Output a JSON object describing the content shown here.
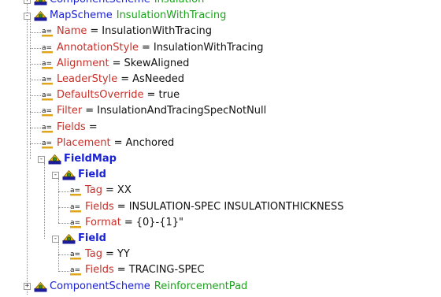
{
  "tree": {
    "rows": [
      {
        "type": "element",
        "name": "ComponentScheme",
        "value": "Insulation",
        "bold": false,
        "expander": "+"
      },
      {
        "type": "element",
        "name": "MapScheme",
        "value": "InsulationWithTracing",
        "bold": false,
        "expander": "-"
      },
      {
        "type": "attribute",
        "name": "Name",
        "value": "InsulationWithTracing"
      },
      {
        "type": "attribute",
        "name": "AnnotationStyle",
        "value": "InsulationWithTracing"
      },
      {
        "type": "attribute",
        "name": "Alignment",
        "value": "SkewAligned"
      },
      {
        "type": "attribute",
        "name": "LeaderStyle",
        "value": "AsNeeded"
      },
      {
        "type": "attribute",
        "name": "DefaultsOverride",
        "value": "true"
      },
      {
        "type": "attribute",
        "name": "Filter",
        "value": "InsulationAndTracingSpecNotNull"
      },
      {
        "type": "attribute",
        "name": "Fields",
        "value": ""
      },
      {
        "type": "attribute",
        "name": "Placement",
        "value": "Anchored"
      },
      {
        "type": "element",
        "name": "FieldMap",
        "value": "",
        "bold": true,
        "expander": "-"
      },
      {
        "type": "element",
        "name": "Field",
        "value": "",
        "bold": true,
        "expander": "-"
      },
      {
        "type": "attribute",
        "name": "Tag",
        "value": "XX"
      },
      {
        "type": "attribute",
        "name": "Fields",
        "value": "INSULATION-SPEC INSULATIONTHICKNESS"
      },
      {
        "type": "attribute",
        "name": "Format",
        "value": "{0}-{1}\""
      },
      {
        "type": "element",
        "name": "Field",
        "value": "",
        "bold": true,
        "expander": "-"
      },
      {
        "type": "attribute",
        "name": "Tag",
        "value": "YY"
      },
      {
        "type": "attribute",
        "name": "Fields",
        "value": "TRACING-SPEC"
      },
      {
        "type": "element",
        "name": "ComponentScheme",
        "value": "ReinforcementPad",
        "bold": false,
        "expander": "+"
      }
    ],
    "equals_sign": "=",
    "attribute_icon_text": "a=",
    "colors": {
      "element_name": "#1a22d6",
      "element_value": "#1aa31a",
      "attribute_name": "#c8302a",
      "attribute_value": "#111111",
      "connector": "#8a8a8a"
    }
  }
}
